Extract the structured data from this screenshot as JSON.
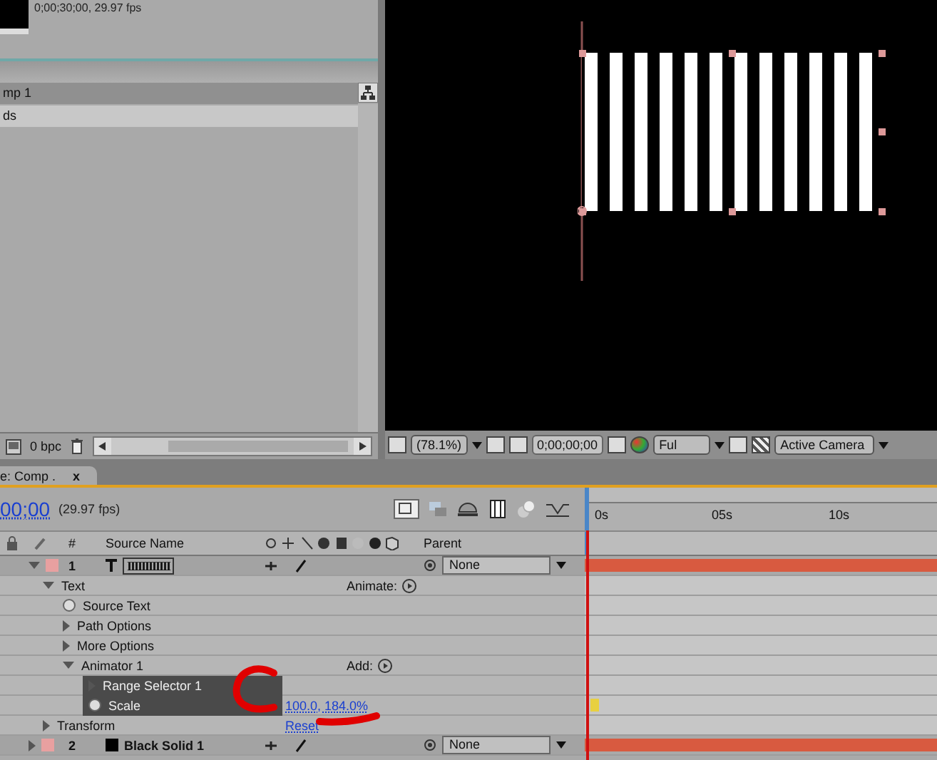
{
  "project_panel": {
    "comp_info": "0;00;30;00, 29.97 fps",
    "items": [
      {
        "name": "mp 1",
        "selected": true
      },
      {
        "name": "ds",
        "selected": false
      }
    ],
    "bit_depth": "0 bpc"
  },
  "viewer_toolbar": {
    "zoom": "(78.1%)",
    "timecode": "0;00;00;00",
    "resolution": "Ful",
    "camera": "Active Camera"
  },
  "timeline": {
    "tab": "e: Comp .",
    "tab_close": "x",
    "current_time": "00;00",
    "fps": "(29.97 fps)",
    "columns": [
      "#",
      "Source Name",
      "Parent"
    ],
    "ruler": [
      "0s",
      "05s",
      "10s"
    ],
    "layers": [
      {
        "number": "1",
        "kind": "text",
        "name": "IIIIIIIIIIII",
        "parent": "None",
        "expanded": true,
        "color": "#e8a0a0",
        "children": [
          {
            "kind": "group",
            "label": "Text",
            "expanded": true,
            "action": "Animate:",
            "children": [
              {
                "kind": "property",
                "label": "Source Text",
                "selected": false
              },
              {
                "kind": "group",
                "label": "Path Options",
                "expanded": false
              },
              {
                "kind": "group",
                "label": "More Options",
                "expanded": false
              },
              {
                "kind": "group",
                "label": "Animator 1",
                "expanded": true,
                "action": "Add:",
                "children": [
                  {
                    "kind": "group",
                    "label": "Range Selector 1",
                    "expanded": false,
                    "selected": true
                  },
                  {
                    "kind": "property",
                    "label": "Scale",
                    "value": "100.0, 184.0%",
                    "selected": true
                  }
                ]
              }
            ]
          },
          {
            "kind": "group",
            "label": "Transform",
            "expanded": false,
            "value": "Reset"
          }
        ]
      },
      {
        "number": "2",
        "kind": "solid",
        "name": "Black Solid 1",
        "parent": "None",
        "expanded": false,
        "color": "#e8a0a0"
      }
    ]
  }
}
